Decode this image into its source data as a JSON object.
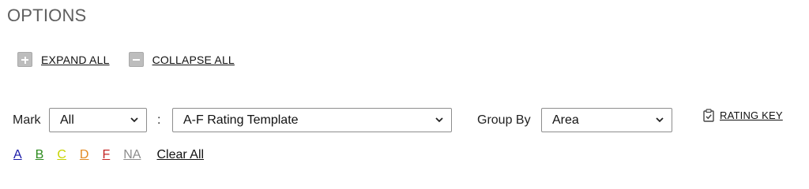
{
  "page": {
    "title": "OPTIONS"
  },
  "tree": {
    "expand_label": "EXPAND ALL",
    "collapse_label": "COLLAPSE ALL"
  },
  "filters": {
    "mark_label": "Mark",
    "mark_value": "All",
    "separator": ":",
    "template_value": "A-F Rating Template",
    "group_by_label": "Group By",
    "group_by_value": "Area",
    "rating_key_label": "RATING KEY"
  },
  "grades": {
    "a": "A",
    "b": "B",
    "c": "C",
    "d": "D",
    "f": "F",
    "na": "NA",
    "clear_all": "Clear All"
  },
  "colors": {
    "grade_a": "#1a1aa8",
    "grade_b": "#2c8a1d",
    "grade_c": "#c7d400",
    "grade_d": "#e38b22",
    "grade_f": "#c42626",
    "grade_na": "#8c8c8c"
  },
  "icons": {
    "expand": "plus-square-icon",
    "collapse": "minus-square-icon",
    "rating_key": "clipboard-check-icon",
    "dropdown": "chevron-down-icon"
  }
}
